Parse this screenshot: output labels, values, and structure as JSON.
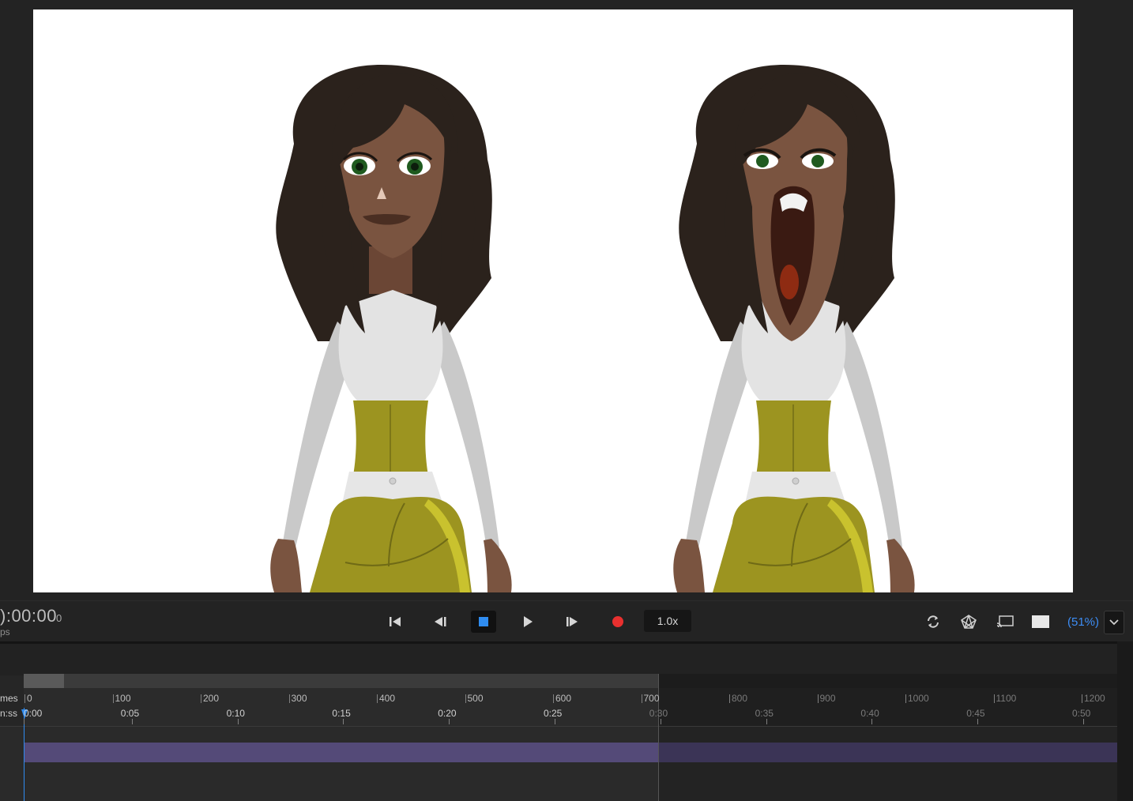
{
  "transport": {
    "timecode": "):00:00",
    "frame": "0",
    "fps_label": "ps",
    "speed": "1.0x",
    "zoom": "(51%)",
    "buttons": [
      {
        "name": "go-to-start",
        "icon": "skip-start-icon"
      },
      {
        "name": "step-back",
        "icon": "step-back-icon"
      },
      {
        "name": "stop",
        "icon": "stop-icon",
        "active": true
      },
      {
        "name": "play",
        "icon": "play-icon"
      },
      {
        "name": "step-forward",
        "icon": "step-forward-icon"
      },
      {
        "name": "record",
        "icon": "record-icon"
      }
    ],
    "right_icons": [
      "refresh-icon",
      "puppet-mesh-icon",
      "cast-icon",
      "background-swatch-icon"
    ]
  },
  "timeline": {
    "row_labels": {
      "frames": "mes",
      "time": "n:ss"
    },
    "frame_ticks": [
      "0",
      "100",
      "200",
      "300",
      "400",
      "500",
      "600",
      "700",
      "800",
      "900",
      "1000",
      "1100",
      "1200"
    ],
    "time_ticks": [
      "0:00",
      "0:05",
      "0:10",
      "0:15",
      "0:20",
      "0:25",
      "0:30",
      "0:35",
      "0:40",
      "0:45",
      "0:50"
    ]
  },
  "colors": {
    "accent": "#2f8cf0",
    "record": "#e8302f",
    "track": "#544a78",
    "zoom_text": "#3d8df5"
  },
  "stage": {
    "characters": [
      "character-neutral",
      "character-mouth-open"
    ]
  }
}
